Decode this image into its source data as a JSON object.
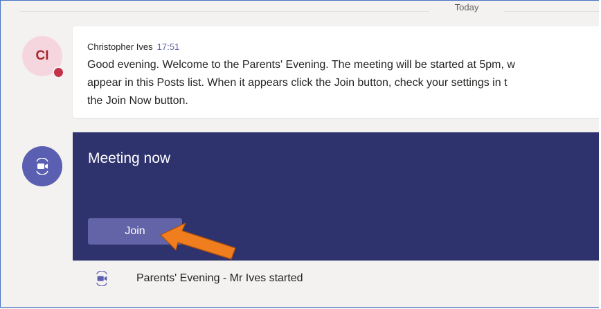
{
  "date_separator": "Today",
  "message": {
    "avatar_initials": "CI",
    "author": "Christopher Ives",
    "time": "17:51",
    "lines": [
      "Good evening. Welcome to the Parents' Evening. The meeting will be started at 5pm, w",
      "appear in this Posts list. When it appears click the Join button, check your settings in t",
      "the Join Now button."
    ]
  },
  "meeting": {
    "title": "Meeting now",
    "join_label": "Join",
    "footer_text": "Parents' Evening - Mr Ives started"
  },
  "colors": {
    "accent": "#6264a7",
    "meeting_card": "#2e336d",
    "arrow": "#f07d1e",
    "presence_busy": "#c4314b"
  },
  "icons": {
    "meeting": "video-camera-icon",
    "presence": "busy-presence-icon",
    "annotation": "arrow-pointer-icon"
  }
}
